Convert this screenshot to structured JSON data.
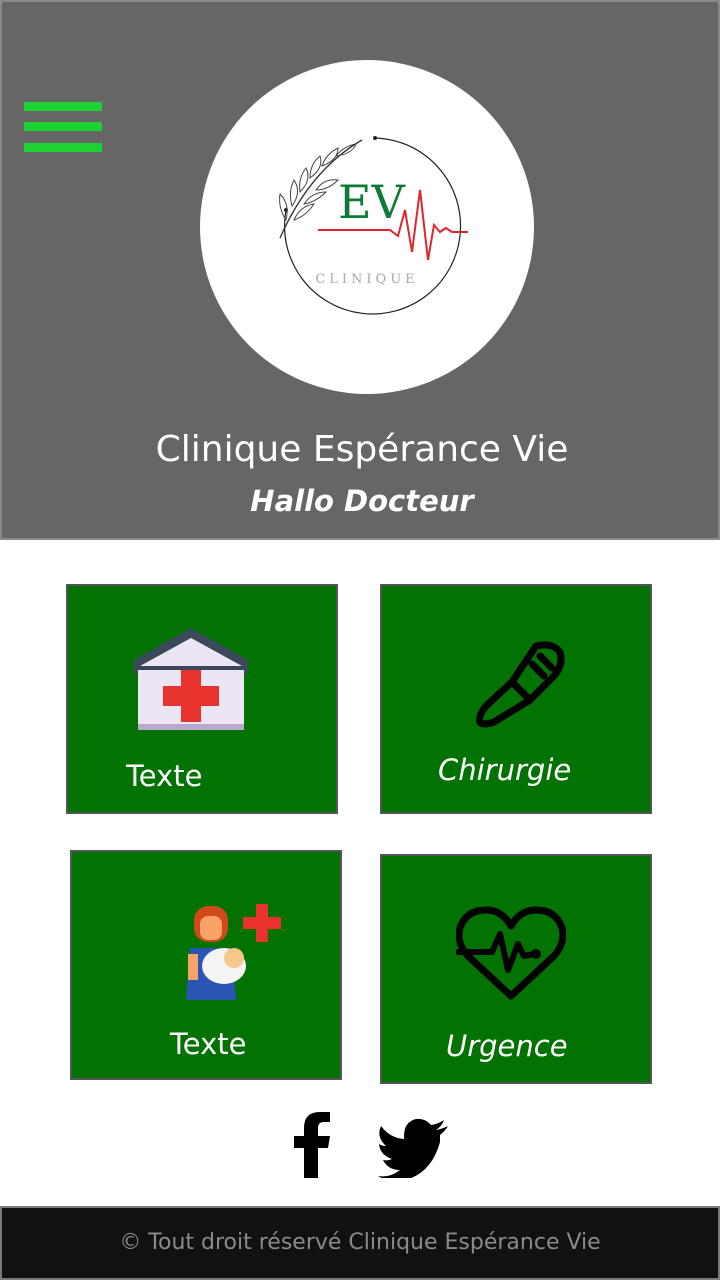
{
  "header": {
    "menu_icon": "hamburger-menu-icon",
    "logo": {
      "initials": "EV",
      "wordmark": "CLINIQUE"
    },
    "title": "Clinique Espérance Vie",
    "subtitle": "Hallo Docteur"
  },
  "tiles": [
    {
      "label": "Texte",
      "icon": "hospital-icon"
    },
    {
      "label": "Chirurgie",
      "icon": "scalpel-icon"
    },
    {
      "label": "Texte",
      "icon": "maternity-icon"
    },
    {
      "label": "Urgence",
      "icon": "heartbeat-icon"
    }
  ],
  "social": {
    "icons": [
      "facebook-icon",
      "twitter-icon"
    ]
  },
  "footer": {
    "copyright": "© Tout droit réservé Clinique Espérance Vie"
  },
  "colors": {
    "header_bg": "#666666",
    "menu_icon": "#1ed234",
    "tile_bg": "#027202",
    "footer_bg": "#111111",
    "logo_green": "#0f7a35",
    "logo_red": "#e0252b"
  }
}
